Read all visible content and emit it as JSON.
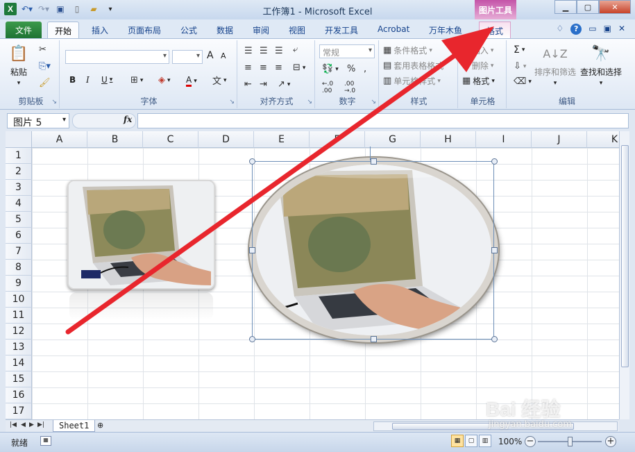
{
  "window": {
    "title": "工作簿1 - Microsoft Excel",
    "context_tab_header": "图片工具",
    "accent_file": "#1f7334",
    "accent_context": "#c454a8",
    "arrow_color": "#e8262d"
  },
  "tabs": [
    {
      "label": "文件"
    },
    {
      "label": "开始"
    },
    {
      "label": "插入"
    },
    {
      "label": "页面布局"
    },
    {
      "label": "公式"
    },
    {
      "label": "数据"
    },
    {
      "label": "审阅"
    },
    {
      "label": "视图"
    },
    {
      "label": "开发工具"
    },
    {
      "label": "Acrobat"
    },
    {
      "label": "万年木鱼"
    },
    {
      "label": "格式"
    }
  ],
  "ribbon": {
    "clipboard": {
      "label": "剪贴板",
      "paste": "粘贴"
    },
    "font": {
      "label": "字体",
      "bold": "B",
      "italic": "I",
      "underline": "U",
      "grow": "A",
      "shrink": "A",
      "color": "A"
    },
    "alignment": {
      "label": "对齐方式"
    },
    "number": {
      "label": "数字",
      "format": "常规"
    },
    "styles": {
      "label": "样式",
      "conditional": "条件格式",
      "table": "套用表格格式",
      "cell": "单元格样式"
    },
    "cells": {
      "label": "单元格",
      "insert": "插入",
      "delete": "删除",
      "format": "格式"
    },
    "editing": {
      "label": "编辑",
      "sort": "排序和筛选",
      "find": "查找和选择",
      "sigma": "Σ"
    }
  },
  "formula_bar": {
    "name_box": "图片 5",
    "fx": "fx",
    "value": ""
  },
  "grid": {
    "columns": [
      "A",
      "B",
      "C",
      "D",
      "E",
      "F",
      "G",
      "H",
      "I",
      "J",
      "K"
    ],
    "rows": [
      "1",
      "2",
      "3",
      "4",
      "5",
      "6",
      "7",
      "8",
      "9",
      "10",
      "11",
      "12",
      "13",
      "14",
      "15",
      "16",
      "17"
    ]
  },
  "sheets": {
    "tabs": [
      "Sheet1"
    ]
  },
  "status": {
    "ready": "就绪",
    "zoom": "100%"
  },
  "watermark": {
    "brand": "Bai 经验",
    "url": "jingyan.baidu.com"
  }
}
